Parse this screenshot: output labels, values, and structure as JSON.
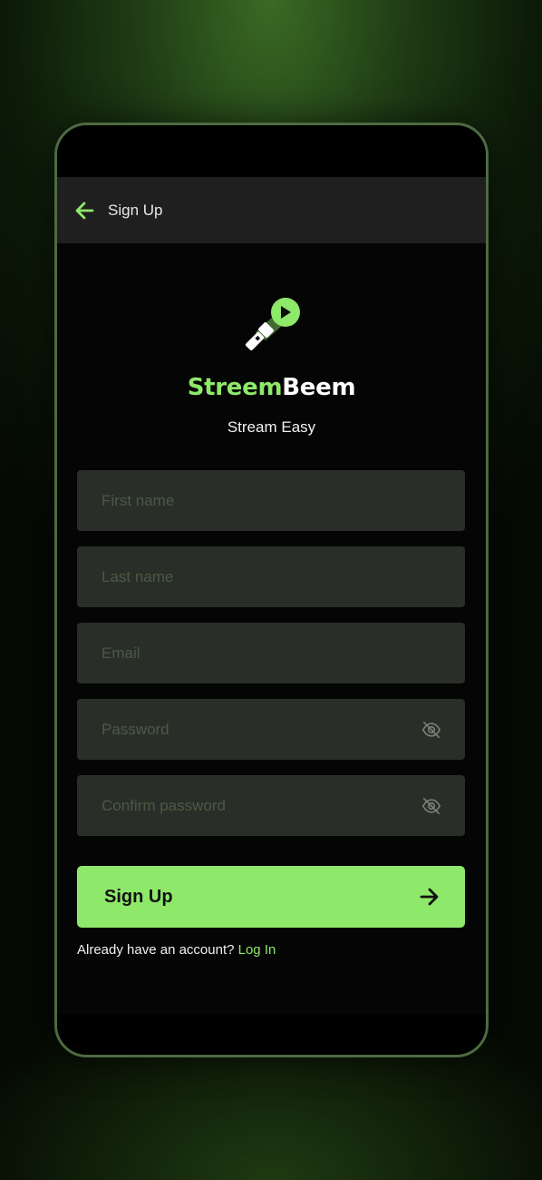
{
  "appbar": {
    "title": "Sign Up"
  },
  "brand": {
    "name_part1": "Streem",
    "name_part2": "Beem",
    "tagline": "Stream Easy"
  },
  "form": {
    "first_name_placeholder": "First name",
    "last_name_placeholder": "Last name",
    "email_placeholder": "Email",
    "password_placeholder": "Password",
    "confirm_password_placeholder": "Confirm password"
  },
  "signup_button": {
    "label": "Sign Up"
  },
  "login_prompt": {
    "text": "Already have an account?",
    "link": "Log In"
  },
  "colors": {
    "accent": "#8ee86a",
    "field_bg": "#2a2e28",
    "appbar_bg": "#1f1f1f",
    "background": "#050505"
  },
  "icons": {
    "back": "arrow-left-icon",
    "logo": "flashlight-play-icon",
    "eye": "eye-off-icon",
    "submit": "arrow-right-icon"
  }
}
